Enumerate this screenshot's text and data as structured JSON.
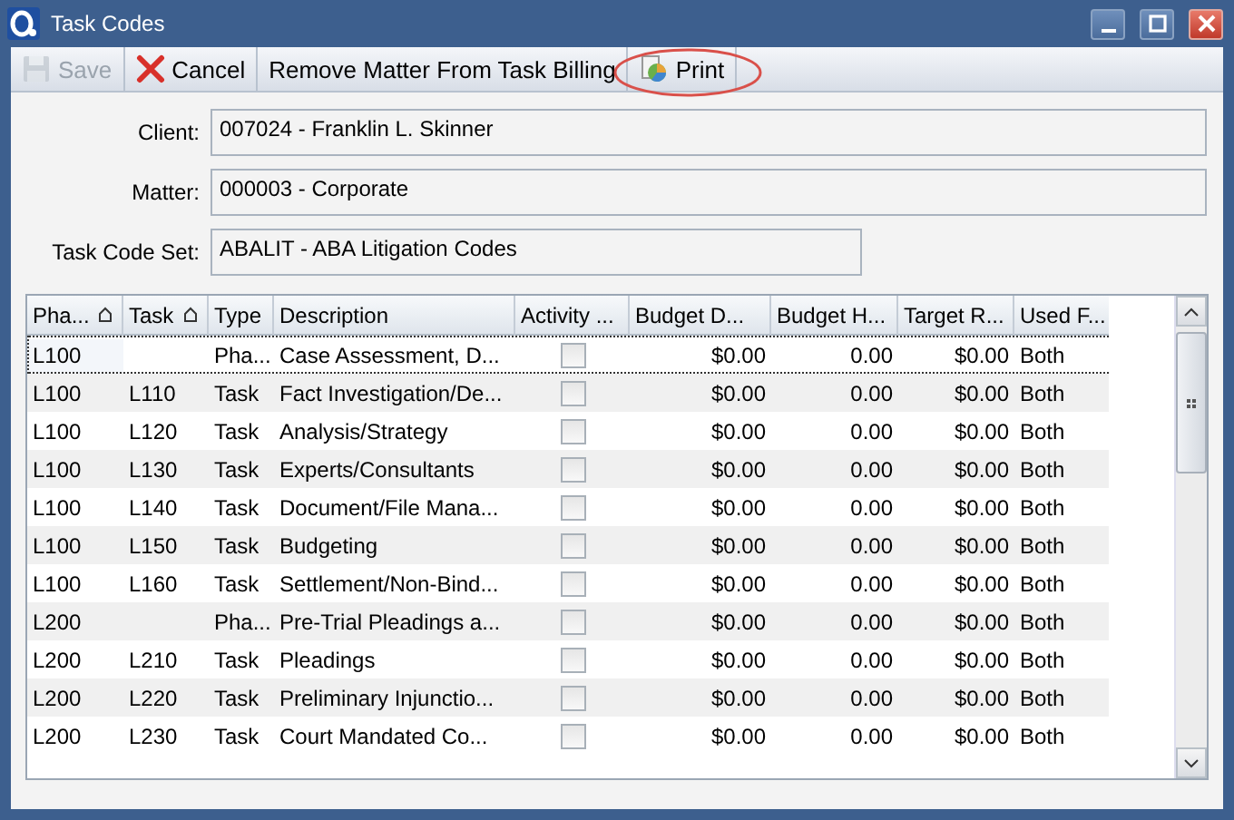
{
  "window": {
    "title": "Task Codes"
  },
  "toolbar": [
    {
      "label": "Save",
      "disabled": true
    },
    {
      "label": "Cancel",
      "disabled": false
    },
    {
      "label": "Remove Matter From Task Billing",
      "disabled": false
    },
    {
      "label": "Print",
      "disabled": false,
      "circled": true
    }
  ],
  "fields": [
    {
      "label": "Client:",
      "value": "007024 - Franklin L. Skinner"
    },
    {
      "label": "Matter:",
      "value": "000003 - Corporate"
    },
    {
      "label": "Task Code Set:",
      "value": "ABALIT - ABA Litigation Codes"
    }
  ],
  "grid": {
    "columns": [
      {
        "label": "Pha...",
        "sorted": true
      },
      {
        "label": "Task",
        "sorted": true
      },
      {
        "label": "Type",
        "sorted": false
      },
      {
        "label": "Description",
        "sorted": false
      },
      {
        "label": "Activity ...",
        "sorted": false
      },
      {
        "label": "Budget D...",
        "sorted": false
      },
      {
        "label": "Budget H...",
        "sorted": false
      },
      {
        "label": "Target R...",
        "sorted": false
      },
      {
        "label": "Used F...",
        "sorted": false
      }
    ],
    "rows": [
      {
        "selected": true,
        "phase": "L100",
        "task": "",
        "type": "Pha...",
        "description": "Case Assessment, D...",
        "activity": false,
        "budget_dollars": "$0.00",
        "budget_hours": "0.00",
        "target_rate": "$0.00",
        "used_for": "Both"
      },
      {
        "selected": false,
        "phase": "L100",
        "task": "L110",
        "type": "Task",
        "description": "Fact Investigation/De...",
        "activity": false,
        "budget_dollars": "$0.00",
        "budget_hours": "0.00",
        "target_rate": "$0.00",
        "used_for": "Both"
      },
      {
        "selected": false,
        "phase": "L100",
        "task": "L120",
        "type": "Task",
        "description": "Analysis/Strategy",
        "activity": false,
        "budget_dollars": "$0.00",
        "budget_hours": "0.00",
        "target_rate": "$0.00",
        "used_for": "Both"
      },
      {
        "selected": false,
        "phase": "L100",
        "task": "L130",
        "type": "Task",
        "description": "Experts/Consultants",
        "activity": false,
        "budget_dollars": "$0.00",
        "budget_hours": "0.00",
        "target_rate": "$0.00",
        "used_for": "Both"
      },
      {
        "selected": false,
        "phase": "L100",
        "task": "L140",
        "type": "Task",
        "description": "Document/File Mana...",
        "activity": false,
        "budget_dollars": "$0.00",
        "budget_hours": "0.00",
        "target_rate": "$0.00",
        "used_for": "Both"
      },
      {
        "selected": false,
        "phase": "L100",
        "task": "L150",
        "type": "Task",
        "description": "Budgeting",
        "activity": false,
        "budget_dollars": "$0.00",
        "budget_hours": "0.00",
        "target_rate": "$0.00",
        "used_for": "Both"
      },
      {
        "selected": false,
        "phase": "L100",
        "task": "L160",
        "type": "Task",
        "description": "Settlement/Non-Bind...",
        "activity": false,
        "budget_dollars": "$0.00",
        "budget_hours": "0.00",
        "target_rate": "$0.00",
        "used_for": "Both"
      },
      {
        "selected": false,
        "phase": "L200",
        "task": "",
        "type": "Pha...",
        "description": "Pre-Trial Pleadings a...",
        "activity": false,
        "budget_dollars": "$0.00",
        "budget_hours": "0.00",
        "target_rate": "$0.00",
        "used_for": "Both"
      },
      {
        "selected": false,
        "phase": "L200",
        "task": "L210",
        "type": "Task",
        "description": "Pleadings",
        "activity": false,
        "budget_dollars": "$0.00",
        "budget_hours": "0.00",
        "target_rate": "$0.00",
        "used_for": "Both"
      },
      {
        "selected": false,
        "phase": "L200",
        "task": "L220",
        "type": "Task",
        "description": "Preliminary Injunctio...",
        "activity": false,
        "budget_dollars": "$0.00",
        "budget_hours": "0.00",
        "target_rate": "$0.00",
        "used_for": "Both"
      },
      {
        "selected": false,
        "phase": "L200",
        "task": "L230",
        "type": "Task",
        "description": "Court Mandated Co...",
        "activity": false,
        "budget_dollars": "$0.00",
        "budget_hours": "0.00",
        "target_rate": "$0.00",
        "used_for": "Both"
      }
    ]
  }
}
